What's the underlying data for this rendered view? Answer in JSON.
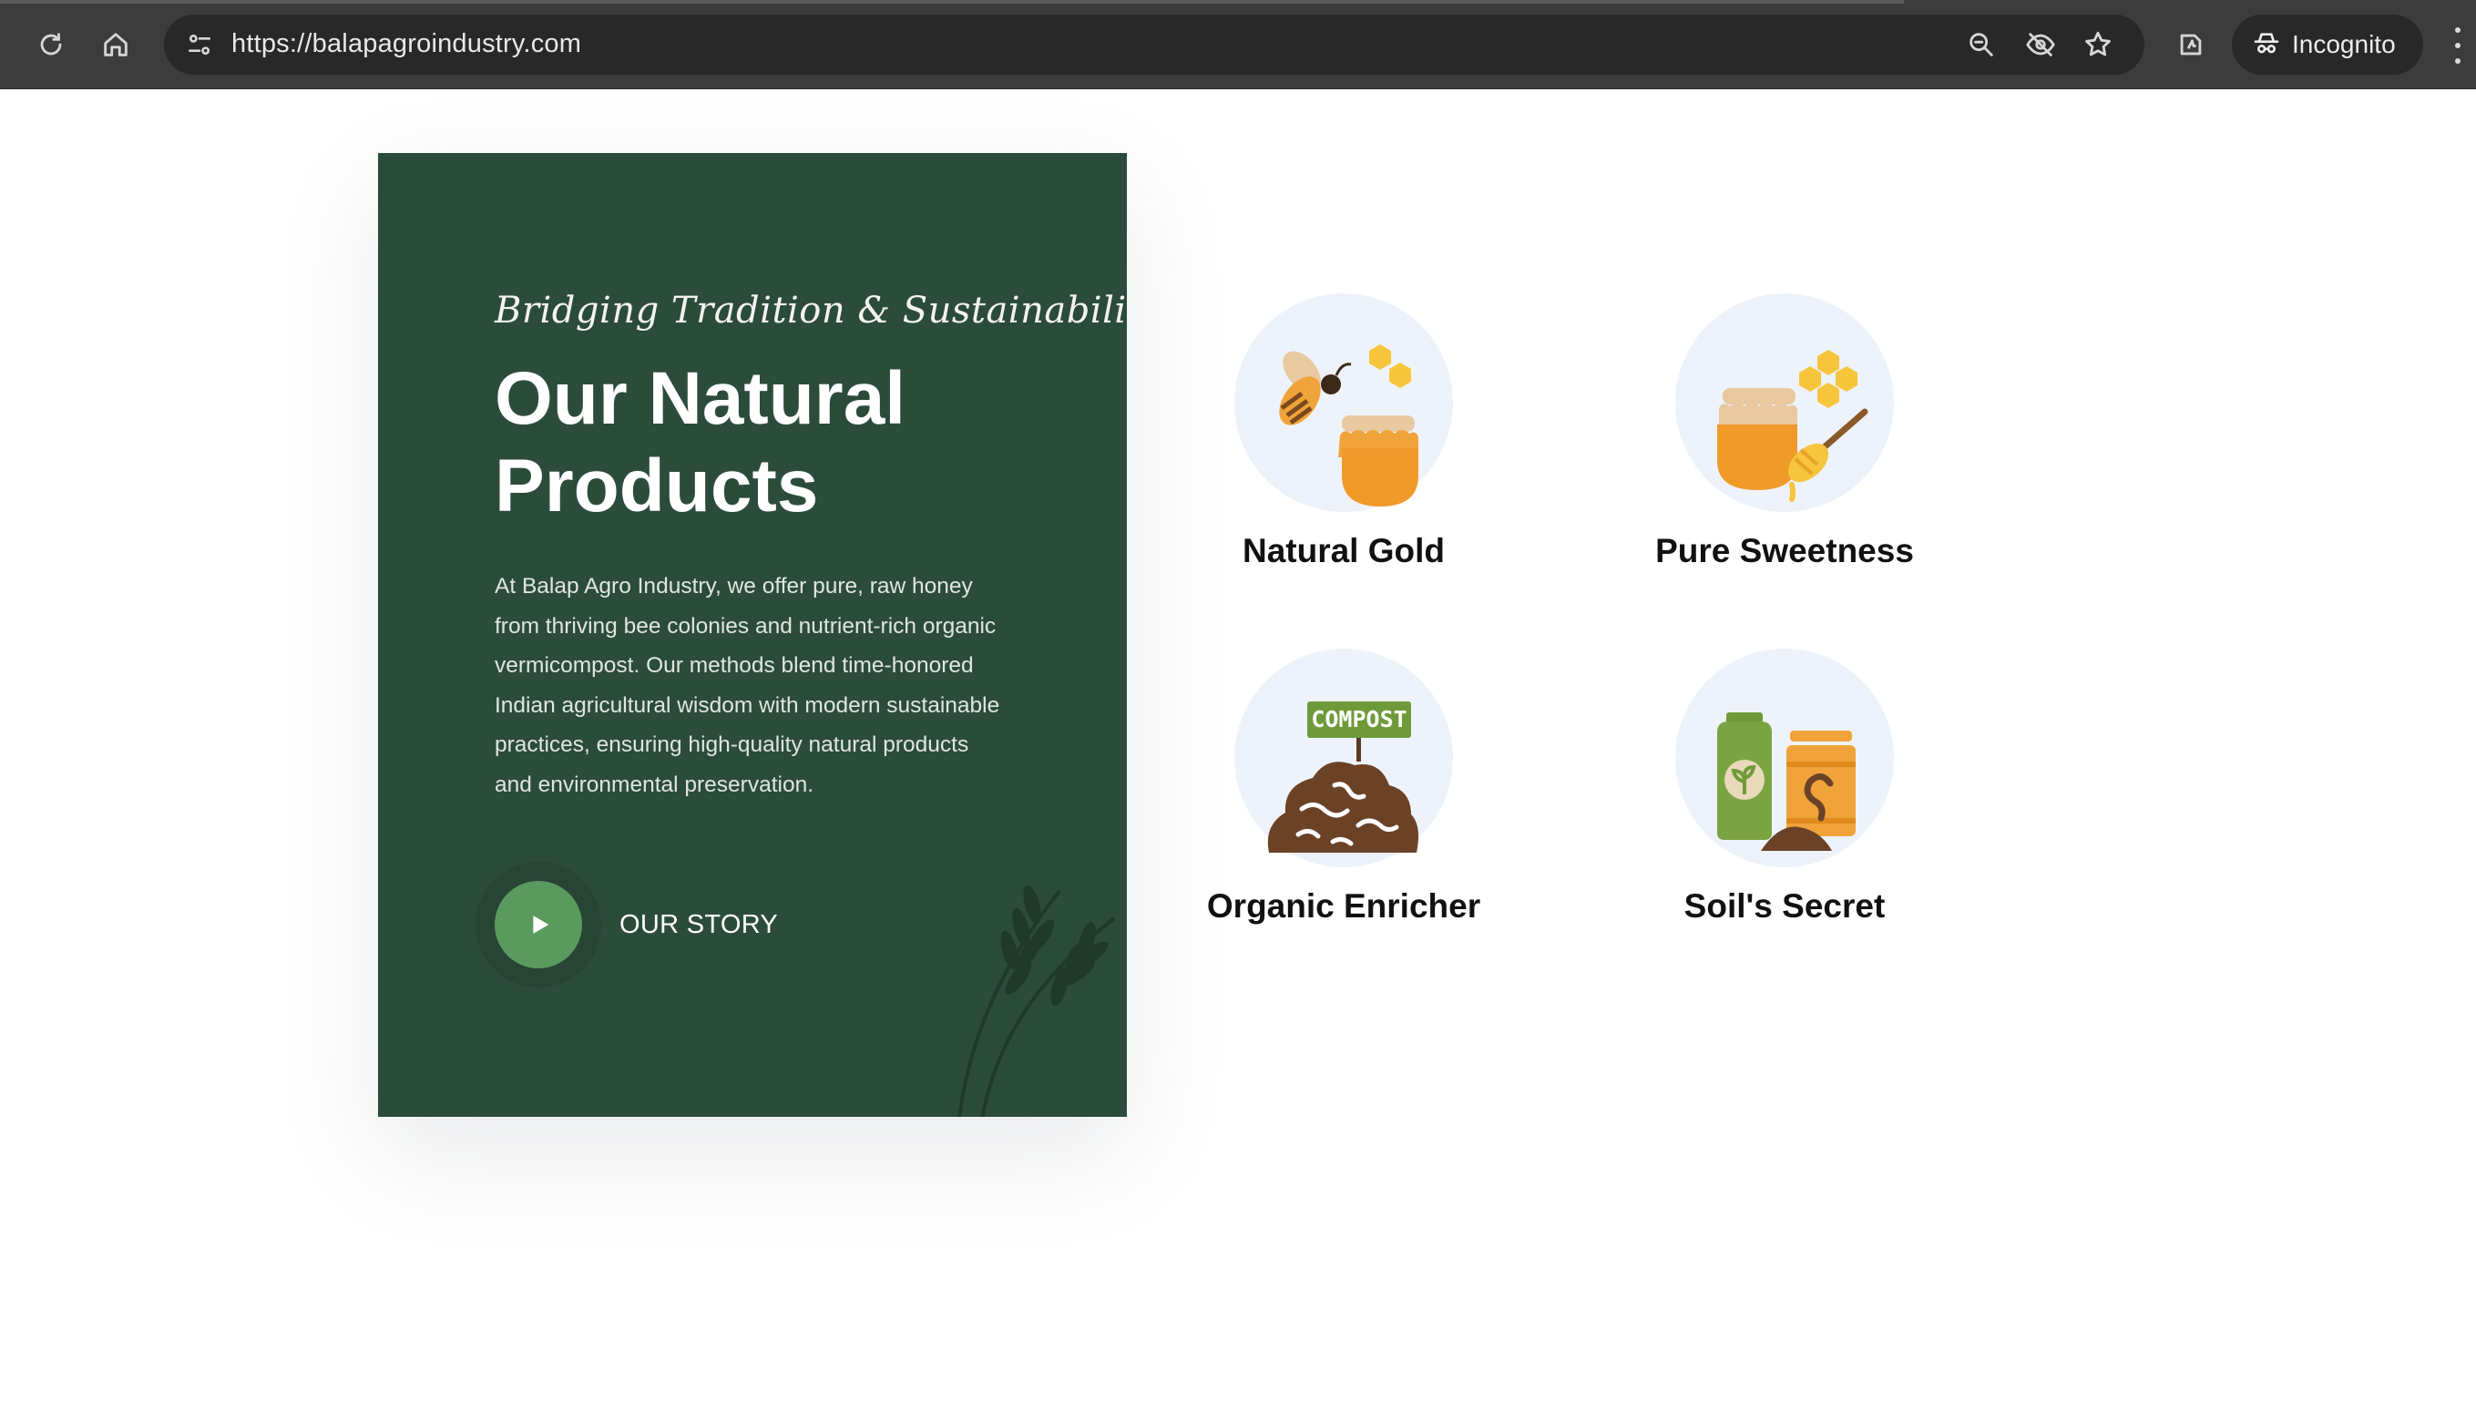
{
  "browser": {
    "url": "https://balapagroindustry.com",
    "profile_label": "Incognito",
    "icons": {
      "reload": "reload-icon",
      "home": "home-icon",
      "site_info": "tune-icon",
      "zoom": "zoom-icon",
      "tracking": "eye-off-icon",
      "bookmark": "star-icon",
      "extension": "extension-icon",
      "incognito": "incognito-icon",
      "menu": "kebab-menu-icon"
    }
  },
  "hero": {
    "tagline": "Bridging Tradition & Sustainability",
    "heading": "Our Natural Products",
    "description": "At Balap Agro Industry, we offer pure, raw honey from thriving bee colonies and nutrient-rich organic vermicompost. Our methods blend time-honored Indian agricultural wisdom with modern sustainable practices, ensuring high-quality natural products and environmental preservation.",
    "story_label": "OUR STORY",
    "colors": {
      "card_bg": "#2c4c3b",
      "play_button": "#5a9a5e"
    }
  },
  "products": [
    {
      "name": "Natural Gold",
      "icon": "bee-honey-jar-icon"
    },
    {
      "name": "Pure Sweetness",
      "icon": "honey-jar-dipper-icon"
    },
    {
      "name": "Organic Enricher",
      "icon": "compost-worms-icon",
      "icon_text": "COMPOST"
    },
    {
      "name": "Soil's Secret",
      "icon": "fertilizer-bag-jar-icon"
    }
  ]
}
